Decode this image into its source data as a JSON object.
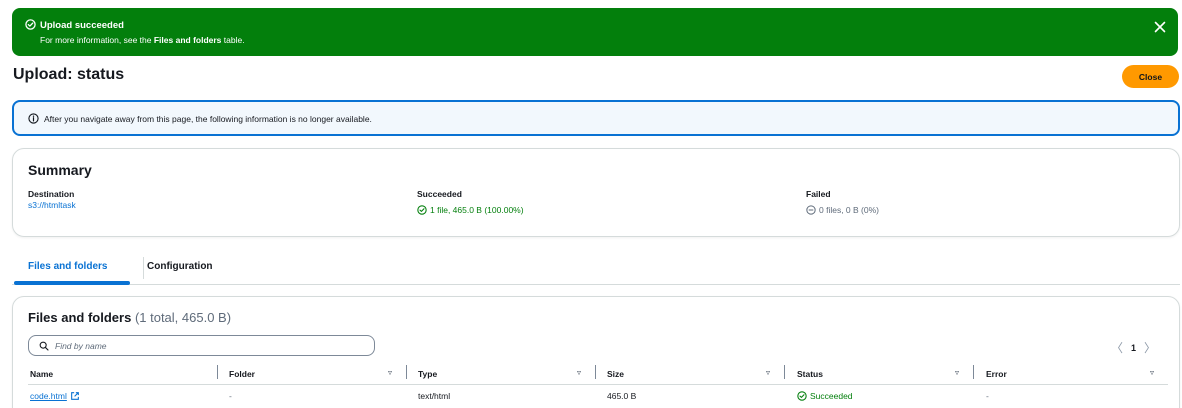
{
  "flash": {
    "title": "Upload succeeded",
    "message_prefix": "For more information, see the ",
    "message_bold": "Files and folders",
    "message_suffix": " table.",
    "icon": "check-circle-icon",
    "close_icon": "close-icon",
    "color": "#037f0c"
  },
  "header": {
    "title": "Upload: status",
    "close_label": "Close",
    "close_color": "#ff9900"
  },
  "info": {
    "text": "After you navigate away from this page, the following information is no longer available.",
    "icon": "info-icon"
  },
  "summary": {
    "title": "Summary",
    "destination_label": "Destination",
    "destination_value": "s3://htmltask",
    "succeeded_label": "Succeeded",
    "succeeded_value": "1 file, 465.0 B (100.00%)",
    "failed_label": "Failed",
    "failed_value": "0 files, 0 B (0%)"
  },
  "tabs": [
    {
      "label": "Files and folders",
      "active": true
    },
    {
      "label": "Configuration",
      "active": false
    }
  ],
  "files": {
    "title": "Files and folders",
    "count": "(1 total, 465.0 B)",
    "search_placeholder": "Find by name",
    "pagination": {
      "current_page": "1",
      "prev": "〈",
      "next": "〉"
    },
    "columns": [
      "Name",
      "Folder",
      "Type",
      "Size",
      "Status",
      "Error"
    ],
    "rows": [
      {
        "name": "code.html",
        "folder": "-",
        "type": "text/html",
        "size": "465.0 B",
        "status": "Succeeded",
        "error": "-"
      }
    ]
  },
  "colors": {
    "link": "#0972d3",
    "success": "#037f0c",
    "accent": "#ff9900"
  }
}
